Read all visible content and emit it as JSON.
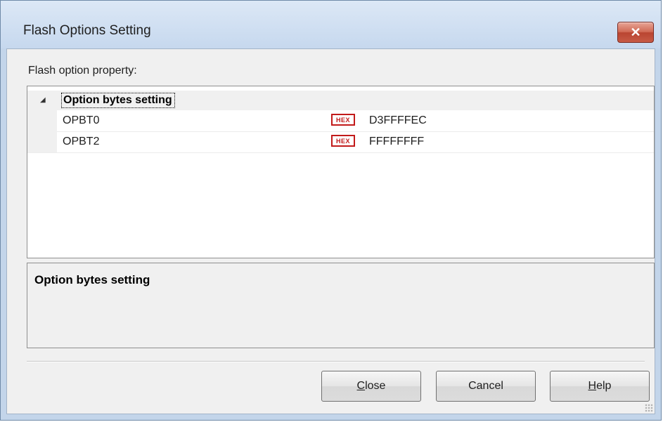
{
  "window": {
    "title": "Flash Options Setting",
    "close_glyph": "✕"
  },
  "property_label": "Flash option property:",
  "grid": {
    "category": {
      "expander_glyph": "◢",
      "label": "Option bytes setting"
    },
    "rows": [
      {
        "name": "OPBT0",
        "badge": "HEX",
        "value": "D3FFFFEC"
      },
      {
        "name": "OPBT2",
        "badge": "HEX",
        "value": "FFFFFFFF"
      }
    ]
  },
  "description": {
    "title": "Option bytes setting"
  },
  "buttons": {
    "close": {
      "mnemonic": "C",
      "rest": "lose"
    },
    "cancel": {
      "label": "Cancel"
    },
    "help": {
      "mnemonic": "H",
      "rest": "elp"
    }
  },
  "colors": {
    "title_bar": "#c6d8ee",
    "close_button": "#c75a45",
    "hex_badge": "#c21a1a"
  }
}
